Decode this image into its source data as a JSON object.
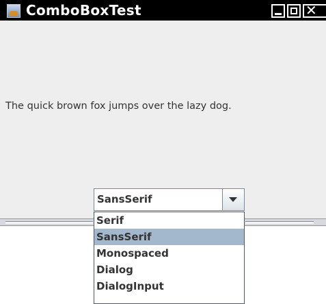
{
  "window": {
    "title": "ComboBoxTest"
  },
  "main": {
    "sample_text": "The quick brown fox jumps over the lazy dog."
  },
  "combo": {
    "selected": "SansSerif",
    "options": [
      {
        "label": "Serif",
        "selected": false
      },
      {
        "label": "SansSerif",
        "selected": true
      },
      {
        "label": "Monospaced",
        "selected": false
      },
      {
        "label": "Dialog",
        "selected": false
      },
      {
        "label": "DialogInput",
        "selected": false
      }
    ]
  },
  "icons": {
    "app": "java-cup-icon",
    "minimize": "minimize-icon",
    "maximize": "maximize-icon",
    "close": "close-icon",
    "dropdown": "chevron-down-icon"
  },
  "colors": {
    "titlebar": "#000000",
    "background": "#eeeeee",
    "selection": "#a3b8cc"
  }
}
